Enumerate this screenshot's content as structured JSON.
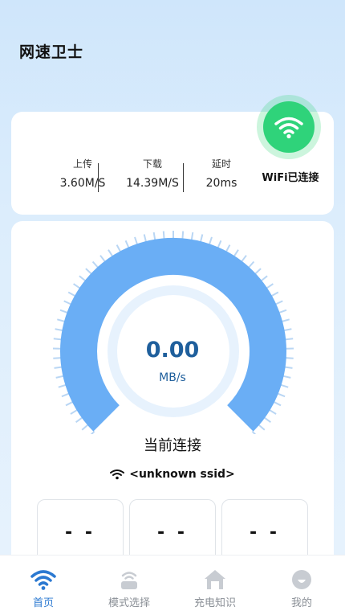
{
  "app": {
    "title": "网速卫士"
  },
  "stats": {
    "upload_label": "上传",
    "upload_value": "3.60M/S",
    "download_label": "下载",
    "download_value": "14.39M/S",
    "latency_label": "延时",
    "latency_value": "20ms"
  },
  "wifi": {
    "status": "WiFi已连接",
    "icon": "wifi-icon"
  },
  "gauge": {
    "value": "0.00",
    "unit": "MB/s"
  },
  "connection": {
    "label": "当前连接",
    "ssid": "<unknown ssid>"
  },
  "metrics": [
    "- -",
    "- -",
    "- -"
  ],
  "nav": [
    {
      "label": "首页",
      "icon": "wifi-icon",
      "active": true
    },
    {
      "label": "模式选择",
      "icon": "router-icon",
      "active": false
    },
    {
      "label": "充电知识",
      "icon": "home-icon",
      "active": false
    },
    {
      "label": "我的",
      "icon": "profile-icon",
      "active": false
    }
  ],
  "colors": {
    "accent": "#2b79d1",
    "gauge": "#6aaef5",
    "wifi_green": "#2fd37a",
    "value_text": "#1f5f9c"
  }
}
